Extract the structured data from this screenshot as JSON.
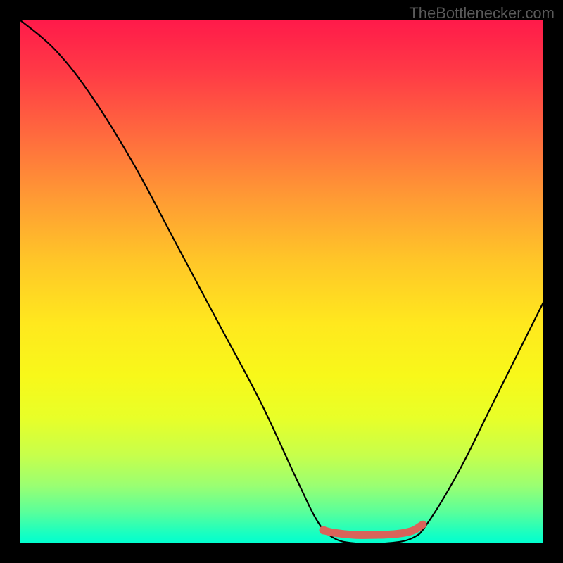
{
  "attribution": "TheBottlenecker.com",
  "chart_data": {
    "type": "line",
    "title": "",
    "xlabel": "",
    "ylabel": "",
    "xlim": [
      0,
      100
    ],
    "ylim": [
      0,
      100
    ],
    "series": [
      {
        "name": "bottleneck-curve",
        "points": [
          {
            "x": 0,
            "y": 100
          },
          {
            "x": 7,
            "y": 94
          },
          {
            "x": 14,
            "y": 85
          },
          {
            "x": 22,
            "y": 72
          },
          {
            "x": 30,
            "y": 57
          },
          {
            "x": 38,
            "y": 42
          },
          {
            "x": 46,
            "y": 27
          },
          {
            "x": 53,
            "y": 12
          },
          {
            "x": 57,
            "y": 4
          },
          {
            "x": 60,
            "y": 1
          },
          {
            "x": 64,
            "y": 0
          },
          {
            "x": 70,
            "y": 0
          },
          {
            "x": 75,
            "y": 1
          },
          {
            "x": 78,
            "y": 4
          },
          {
            "x": 84,
            "y": 14
          },
          {
            "x": 90,
            "y": 26
          },
          {
            "x": 96,
            "y": 38
          },
          {
            "x": 100,
            "y": 46
          }
        ]
      },
      {
        "name": "optimal-range-marker",
        "points": [
          {
            "x": 58,
            "y": 2.5
          },
          {
            "x": 60,
            "y": 2
          },
          {
            "x": 64,
            "y": 1.6
          },
          {
            "x": 68,
            "y": 1.6
          },
          {
            "x": 72,
            "y": 1.8
          },
          {
            "x": 75,
            "y": 2.4
          },
          {
            "x": 77,
            "y": 3.6
          }
        ]
      }
    ],
    "background_gradient": {
      "top_color": "#ff1a4a",
      "bottom_color": "#00ffd0",
      "description": "red-to-green vertical gradient indicating bottleneck severity"
    }
  }
}
